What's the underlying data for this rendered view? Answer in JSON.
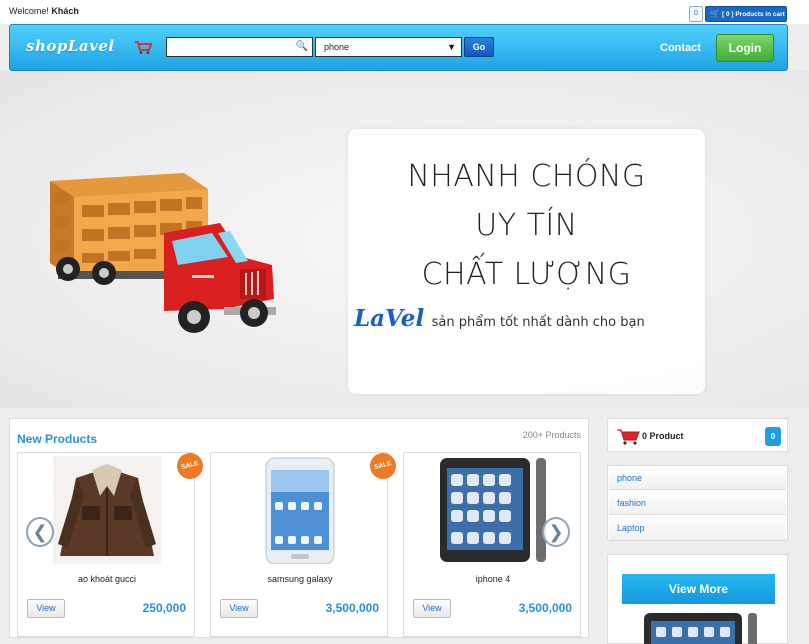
{
  "topbar": {
    "welcome_prefix": "Welcome!",
    "user_name": "Khách",
    "mini_count": "0",
    "cart_label": "[ 0 ] Products in cart"
  },
  "header": {
    "logo_text": "shopLavel",
    "search": {
      "placeholder": "",
      "value": ""
    },
    "category_select": {
      "selected": "phone"
    },
    "go_label": "Go",
    "contact_label": "Contact",
    "login_label": "Login"
  },
  "banner": {
    "line1": "NHANH CHÓNG",
    "line2": "UY TÍN",
    "line3": "CHẤT LƯỢNG",
    "brand": "LaVel",
    "tagline": "sản phẩm tốt nhất dành cho bạn"
  },
  "new_products": {
    "title": "New Products",
    "count": "200+ Products",
    "prev_arrow": "❮",
    "next_arrow": "❯",
    "items": [
      {
        "name": "ao khoát gucci",
        "price": "250,000",
        "view_label": "View",
        "sale": "SALE"
      },
      {
        "name": "samsung galaxy",
        "price": "3,500,000",
        "view_label": "View",
        "sale": "SALE"
      },
      {
        "name": "iphone 4",
        "price": "3,500,000",
        "view_label": "View",
        "sale": ""
      }
    ]
  },
  "sidebar": {
    "cart_label": "0 Product",
    "cart_count": "0",
    "categories": [
      "phone",
      "fashion",
      "Laptop"
    ],
    "view_more_label": "View More"
  },
  "colors": {
    "header_blue": "#1ea3e6",
    "accent_blue": "#2792d8",
    "login_green": "#3fae36",
    "sale_orange": "#ee7a22"
  }
}
